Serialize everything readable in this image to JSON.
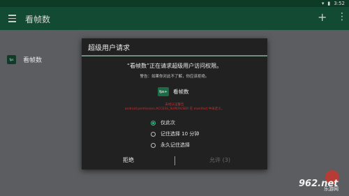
{
  "status_bar": {
    "time": "3:52"
  },
  "app_bar": {
    "title": "看帧数",
    "add_label": "+",
    "more_label": "⋮"
  },
  "list": {
    "items": [
      {
        "icon_text": "fps",
        "label": "看帧数"
      }
    ]
  },
  "dialog": {
    "title": "超级用户请求",
    "heading": "“看帧数”正在请求超级用户访问权限。",
    "warning": "警告：如果你对此不了解，你应该拒绝。",
    "app": {
      "icon_text": "fps+",
      "name": "看帧数"
    },
    "error_line1": "未经认证警告",
    "error_line2": "android.permission.ACCESS_SUPERUSER 在 manifest 中未定义。",
    "options": [
      {
        "label": "仅此次",
        "selected": true
      },
      {
        "label": "记住选择 10 分钟",
        "selected": false
      },
      {
        "label": "永久记住选择",
        "selected": false
      }
    ],
    "deny_label": "拒绝",
    "allow_label": "允许 (3)"
  },
  "watermark": {
    "main": "962.net",
    "sub": "乐游网"
  },
  "colors": {
    "appbar": "#124a33",
    "accent": "#2fbf85",
    "error": "#d23030",
    "dialog_bg": "#212121"
  }
}
